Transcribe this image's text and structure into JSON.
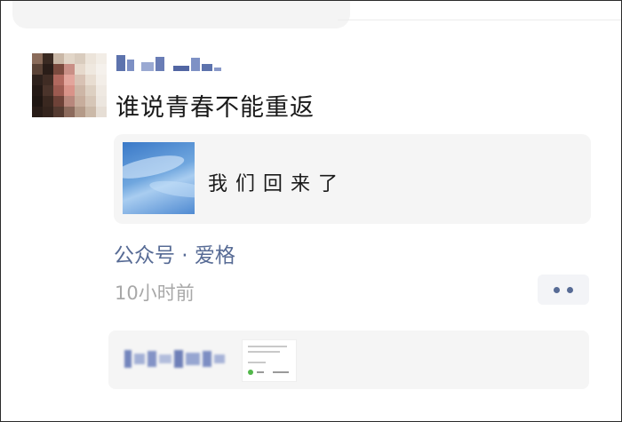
{
  "post": {
    "text": "谁说青春不能重返",
    "link_card": {
      "title": "我们回来了"
    },
    "source": "公众号 · 爱格",
    "time": "10小时前"
  },
  "colors": {
    "link_blue": "#576b95",
    "time_gray": "#a8a8a8",
    "card_bg": "#f5f5f5"
  },
  "icons": {
    "more": "two-dots-icon"
  }
}
